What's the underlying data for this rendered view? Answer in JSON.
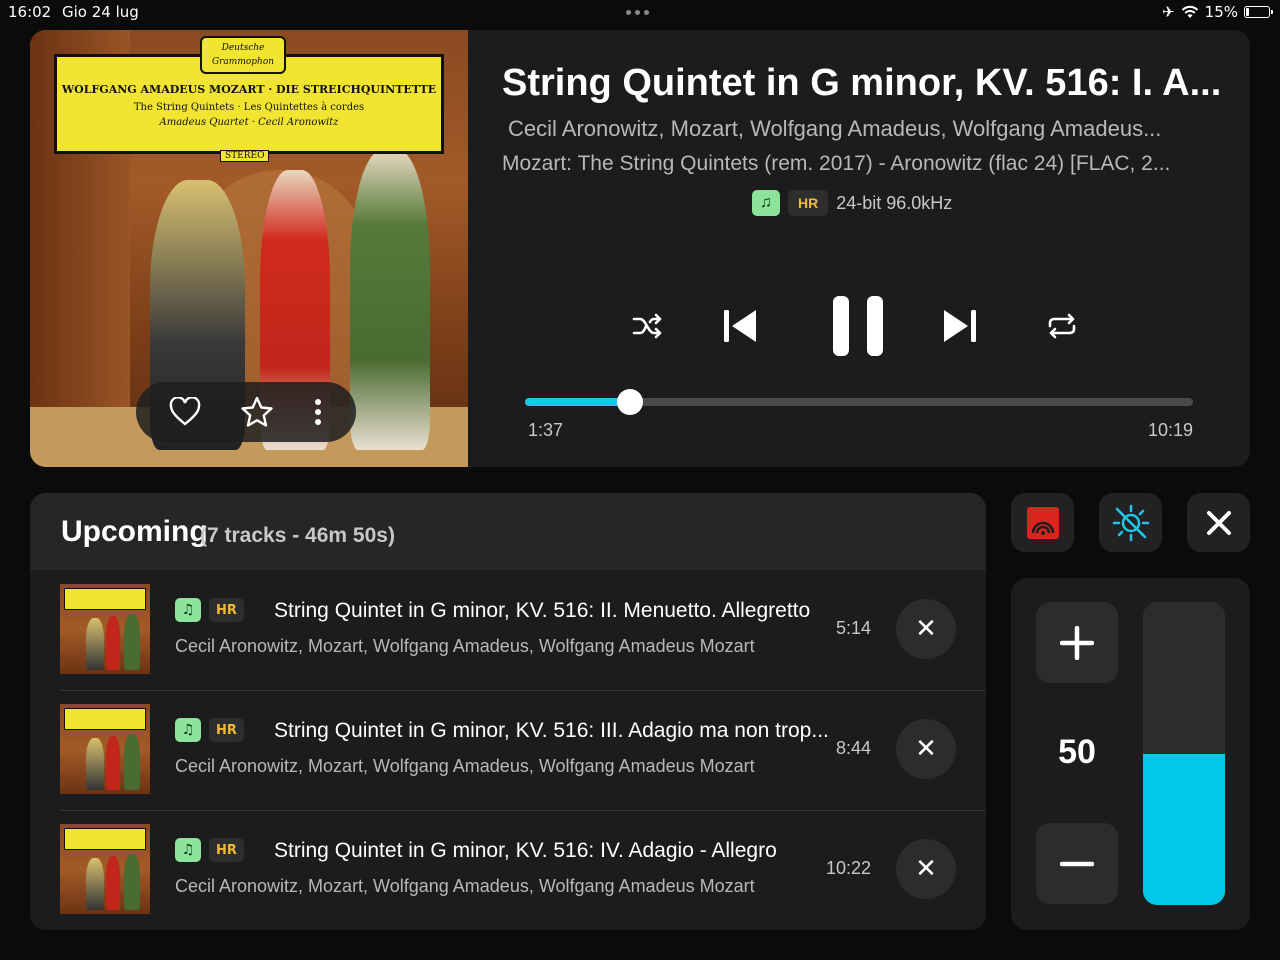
{
  "status_bar": {
    "time": "16:02",
    "date": "Gio 24 lug",
    "battery": "15%",
    "battery_level": 0.15
  },
  "album_cover": {
    "label_brand": "Deutsche Grammophon",
    "label_line1": "WOLFGANG AMADEUS MOZART · DIE STREICHQUINTETTE",
    "label_line2": "The String Quintets · Les Quintettes à cordes",
    "label_line3": "Amadeus Quartet · Cecil Aronowitz",
    "label_stereo": "STEREO"
  },
  "now_playing": {
    "title": "String Quintet in G minor, KV. 516: I. A...",
    "artists": "Cecil Aronowitz, Mozart, Wolfgang Amadeus, Wolfgang Amadeus...",
    "album": "Mozart: The String Quintets (rem. 2017) -  Aronowitz (flac 24) [FLAC, 2...",
    "quality_badge": "HR",
    "quality_text": "24-bit 96.0kHz",
    "elapsed": "1:37",
    "duration": "10:19",
    "progress": 0.157
  },
  "colors": {
    "accent": "#1fc6e8",
    "hr_badge": "#f0b93c",
    "quality_icon": "#8de39a",
    "output_red": "#d9251d"
  },
  "upcoming": {
    "heading": "Upcoming",
    "count": "(7 tracks - 46m 50s)",
    "tracks": [
      {
        "title": "String Quintet in G minor, KV. 516: II. Menuetto. Allegretto",
        "artists": "Cecil Aronowitz, Mozart, Wolfgang Amadeus, Wolfgang Amadeus Mozart",
        "duration": "5:14",
        "badge": "HR"
      },
      {
        "title": "String Quintet in G minor, KV. 516: III. Adagio ma non trop...",
        "artists": "Cecil Aronowitz, Mozart, Wolfgang Amadeus, Wolfgang Amadeus Mozart",
        "duration": "8:44",
        "badge": "HR"
      },
      {
        "title": "String Quintet in G minor, KV. 516: IV. Adagio - Allegro",
        "artists": "Cecil Aronowitz, Mozart, Wolfgang Amadeus, Wolfgang Amadeus Mozart",
        "duration": "10:22",
        "badge": "HR"
      }
    ]
  },
  "volume": {
    "value": "50",
    "level": 0.5
  },
  "icons": [
    "heart-icon",
    "star-icon",
    "more-vertical-icon",
    "shuffle-icon",
    "previous-icon",
    "pause-icon",
    "next-icon",
    "repeat-icon",
    "airplay-icon",
    "brightness-icon",
    "close-icon",
    "plus-icon",
    "minus-icon",
    "music-note-icon"
  ]
}
